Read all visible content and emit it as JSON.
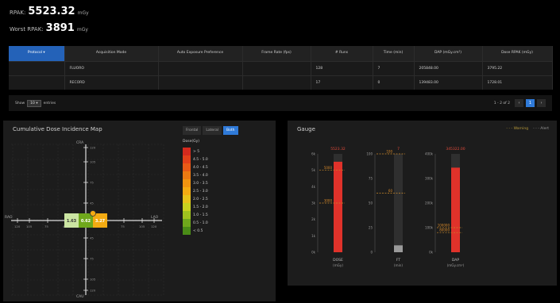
{
  "header": {
    "rpak_label": "RPAK:",
    "rpak_value": "5523.32",
    "rpak_unit": "mGy",
    "worst_label": "Worst RPAK:",
    "worst_value": "3891",
    "worst_unit": "mGy"
  },
  "table": {
    "columns": [
      "Protocol",
      "Acquisition Mode",
      "Auto Exposure Preference",
      "Frame Rate (fps)",
      "# Runs",
      "Time (min)",
      "DAP (mGy.cm²)",
      "Dose RPAK (mGy)"
    ],
    "rows": [
      [
        "",
        "FLUORO",
        "",
        "",
        "128",
        "7",
        "205848.00",
        "3795.22"
      ],
      [
        "",
        "RECORD",
        "",
        "",
        "17",
        "0",
        "139483.00",
        "1728.01"
      ]
    ]
  },
  "pager": {
    "show_label": "Show",
    "page_size": "10 ▾",
    "entries_label": "entries",
    "range": "1 - 2 of 2",
    "prev": "‹",
    "current": "1",
    "next": "›"
  },
  "cdim": {
    "title": "Cumulative Dose Incidence Map",
    "views": [
      "Frontal",
      "Lateral",
      "Both"
    ],
    "active_view": "Both",
    "legend_title": "Dose(Gy)",
    "legend": [
      {
        "label": "> 5",
        "color": "#d42a1e"
      },
      {
        "label": "4.5 - 5.0",
        "color": "#e2401a"
      },
      {
        "label": "4.0 - 4.5",
        "color": "#e85a16"
      },
      {
        "label": "3.5 - 4.0",
        "color": "#ec7a12"
      },
      {
        "label": "3.0 - 3.5",
        "color": "#f09410"
      },
      {
        "label": "2.5 - 3.0",
        "color": "#f3ab12"
      },
      {
        "label": "2.0 - 2.5",
        "color": "#e7c31a"
      },
      {
        "label": "1.5 - 2.0",
        "color": "#c9d21f"
      },
      {
        "label": "1.0 - 1.5",
        "color": "#9fc21e"
      },
      {
        "label": "0.5 - 1.0",
        "color": "#6fa81c"
      },
      {
        "label": "< 0.5",
        "color": "#4a8c17"
      }
    ],
    "axis_top": "CRA",
    "axis_bottom": "CAU",
    "axis_left": "RAO",
    "axis_right": "LAO",
    "y_ticks": [
      "120",
      "105",
      "75",
      "45",
      "15",
      "15",
      "45",
      "75",
      "105",
      "120"
    ],
    "x_ticks": [
      "120",
      "105",
      "75",
      "45",
      "15",
      "15",
      "45",
      "75",
      "105",
      "120"
    ],
    "cells": [
      {
        "label": "1.63",
        "color": "#cbe5a2",
        "text": "#333"
      },
      {
        "label": "0.62",
        "color": "#6fa81c",
        "text": "#fff"
      },
      {
        "label": "3.27",
        "color": "#f3ab12",
        "text": "#fff"
      }
    ]
  },
  "gauge": {
    "title": "Gauge",
    "legend_warning": "Warning",
    "legend_alert": "Alert",
    "bars": [
      {
        "name": "DOSE",
        "unit": "(mGy)",
        "value_label": "5523.32",
        "fill": 0.92,
        "ticks": [
          "6k",
          "5k",
          "4k",
          "3k",
          "2k",
          "1k",
          "0k"
        ],
        "marks": [
          {
            "label": "5000",
            "at": 0.833
          },
          {
            "label": "3000",
            "at": 0.5
          }
        ],
        "color": "#e0322a"
      },
      {
        "name": "FT",
        "unit": "(min)",
        "value_label": "7",
        "fill": 0.07,
        "ticks": [
          "100",
          "75",
          "50",
          "25",
          "0"
        ],
        "marks": [
          {
            "label": "100",
            "at": 1.0
          },
          {
            "label": "60",
            "at": 0.6
          }
        ],
        "color": "#9a9a9a"
      },
      {
        "name": "DAP",
        "unit": "(mGy.cm²)",
        "value_label": "345322.00",
        "fill": 0.86,
        "ticks": [
          "400k",
          "300k",
          "200k",
          "100k",
          "0k"
        ],
        "marks": [
          {
            "label": "100000",
            "at": 0.25
          },
          {
            "label": "80000",
            "at": 0.2
          }
        ],
        "color": "#e0322a"
      }
    ]
  }
}
